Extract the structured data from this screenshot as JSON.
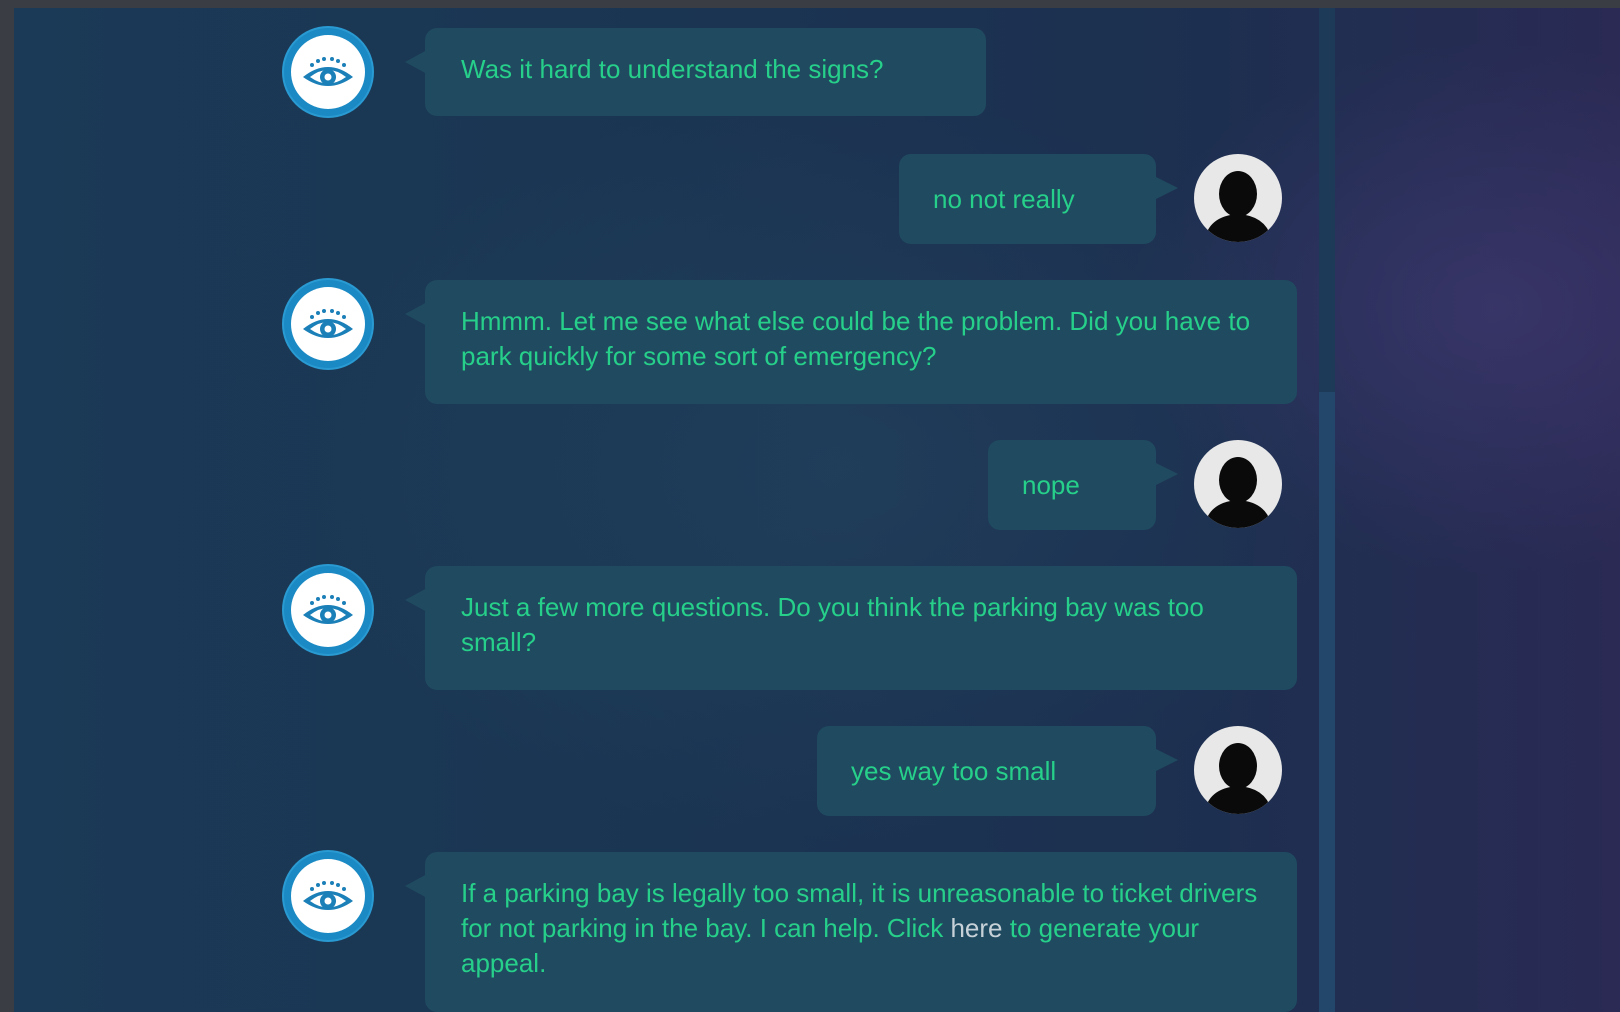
{
  "messages": [
    {
      "sender": "bot",
      "text": "Was it hard to understand the signs?"
    },
    {
      "sender": "user",
      "text": "no not really"
    },
    {
      "sender": "bot",
      "text": "Hmmm. Let me see what else could be the problem. Did you have to park quickly for some sort of emergency?"
    },
    {
      "sender": "user",
      "text": "nope"
    },
    {
      "sender": "bot",
      "text": "Just a few more questions. Do you think the parking bay was too small?"
    },
    {
      "sender": "user",
      "text": "yes way too small"
    },
    {
      "sender": "bot",
      "text_before": "If a parking bay is legally too small, it is unreasonable to ticket drivers for not parking in the bay. I can help. Click ",
      "link_text": "here",
      "text_after": " to generate your appeal."
    }
  ],
  "icons": {
    "bot_avatar": "eye-icon",
    "user_avatar": "user-silhouette-icon"
  },
  "colors": {
    "bubble": "#1f4a5f",
    "message_text": "#27d08a",
    "link_text": "#c7d1d8",
    "bot_avatar_ring": "#1b8ac4"
  }
}
